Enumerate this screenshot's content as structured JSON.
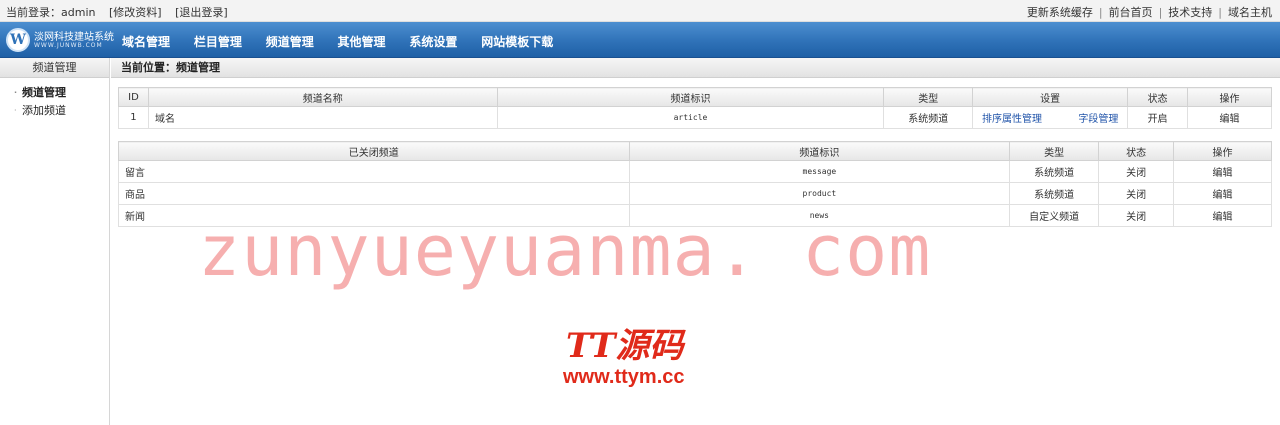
{
  "topbar": {
    "login_text": "当前登录：admin",
    "edit_profile": "[修改资料]",
    "logout": "[退出登录]",
    "links": [
      "更新系统缓存",
      "前台首页",
      "技术支持",
      "域名主机"
    ]
  },
  "logo": {
    "mark": "W",
    "title": "淡网科技建站系统",
    "url": "WWW.JUNWB.COM"
  },
  "nav": {
    "items": [
      "域名管理",
      "栏目管理",
      "频道管理",
      "其他管理",
      "系统设置",
      "网站模板下载"
    ]
  },
  "sidebar": {
    "title": "频道管理",
    "items": [
      "频道管理",
      "添加频道"
    ]
  },
  "location": "当前位置：频道管理",
  "open_table": {
    "headers": [
      "ID",
      "频道名称",
      "频道标识",
      "类型",
      "设置",
      "状态",
      "操作"
    ],
    "rows": [
      {
        "id": "1",
        "name": "域名",
        "identifier": "article",
        "type": "系统频道",
        "setting1": "排序属性管理",
        "setting2": "字段管理",
        "status": "开启",
        "action": "编辑"
      }
    ]
  },
  "closed_table": {
    "headers": [
      "已关闭频道",
      "频道标识",
      "类型",
      "状态",
      "操作"
    ],
    "rows": [
      {
        "name": "留言",
        "identifier": "message",
        "type": "系统频道",
        "status": "关闭",
        "action": "编辑"
      },
      {
        "name": "商品",
        "identifier": "product",
        "type": "系统频道",
        "status": "关闭",
        "action": "编辑"
      },
      {
        "name": "新闻",
        "identifier": "news",
        "type": "自定义频道",
        "status": "关闭",
        "action": "编辑"
      }
    ]
  },
  "watermark": {
    "main": "zunyueyuanma. com",
    "brand": "TT源码",
    "url": "www.ttym.cc"
  },
  "colors": {
    "nav_blue": "#2f72b8",
    "link_blue": "#2255aa",
    "status_red": "#b41e1e",
    "watermark_pink": "#ee6e6e"
  }
}
